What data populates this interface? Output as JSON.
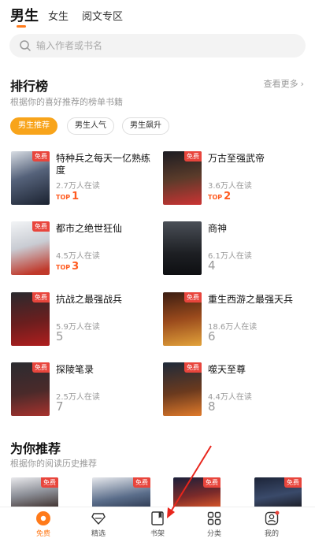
{
  "top_tabs": [
    {
      "label": "男生"
    },
    {
      "label": "女生"
    },
    {
      "label": "阅文专区"
    }
  ],
  "search": {
    "placeholder": "输入作者或书名"
  },
  "ranking": {
    "title": "排行榜",
    "subtitle": "根据你的喜好推荐的榜单书籍",
    "more": "查看更多",
    "filters": [
      {
        "label": "男生推荐"
      },
      {
        "label": "男生人气"
      },
      {
        "label": "男生飙升"
      }
    ],
    "free_tag": "免费",
    "top_word": "TOP",
    "books": [
      {
        "title": "特种兵之每天一亿熟练度",
        "readers": "2.7万人在读",
        "rank": "1"
      },
      {
        "title": "万古至强武帝",
        "readers": "3.6万人在读",
        "rank": "2"
      },
      {
        "title": "都市之绝世狂仙",
        "readers": "4.5万人在读",
        "rank": "3"
      },
      {
        "title": "商神",
        "readers": "6.1万人在读",
        "rank": "4"
      },
      {
        "title": "抗战之最强战兵",
        "readers": "5.9万人在读",
        "rank": "5"
      },
      {
        "title": "重生西游之最强天兵",
        "readers": "18.6万人在读",
        "rank": "6"
      },
      {
        "title": "探陵笔录",
        "readers": "2.5万人在读",
        "rank": "7"
      },
      {
        "title": "噬天至尊",
        "readers": "4.4万人在读",
        "rank": "8"
      }
    ]
  },
  "recommend": {
    "title": "为你推荐",
    "subtitle": "根据你的阅读历史推荐"
  },
  "bottom_nav": [
    {
      "label": "免费",
      "icon": "free-icon"
    },
    {
      "label": "精选",
      "icon": "diamond-icon"
    },
    {
      "label": "书架",
      "icon": "bookshelf-icon"
    },
    {
      "label": "分类",
      "icon": "category-icon"
    },
    {
      "label": "我的",
      "icon": "profile-icon"
    }
  ],
  "colors": {
    "accent": "#ff7a1a",
    "pill_active": "#f8a41b",
    "free_tag": "#e8453c",
    "top_rank": "#ff5a1f"
  }
}
